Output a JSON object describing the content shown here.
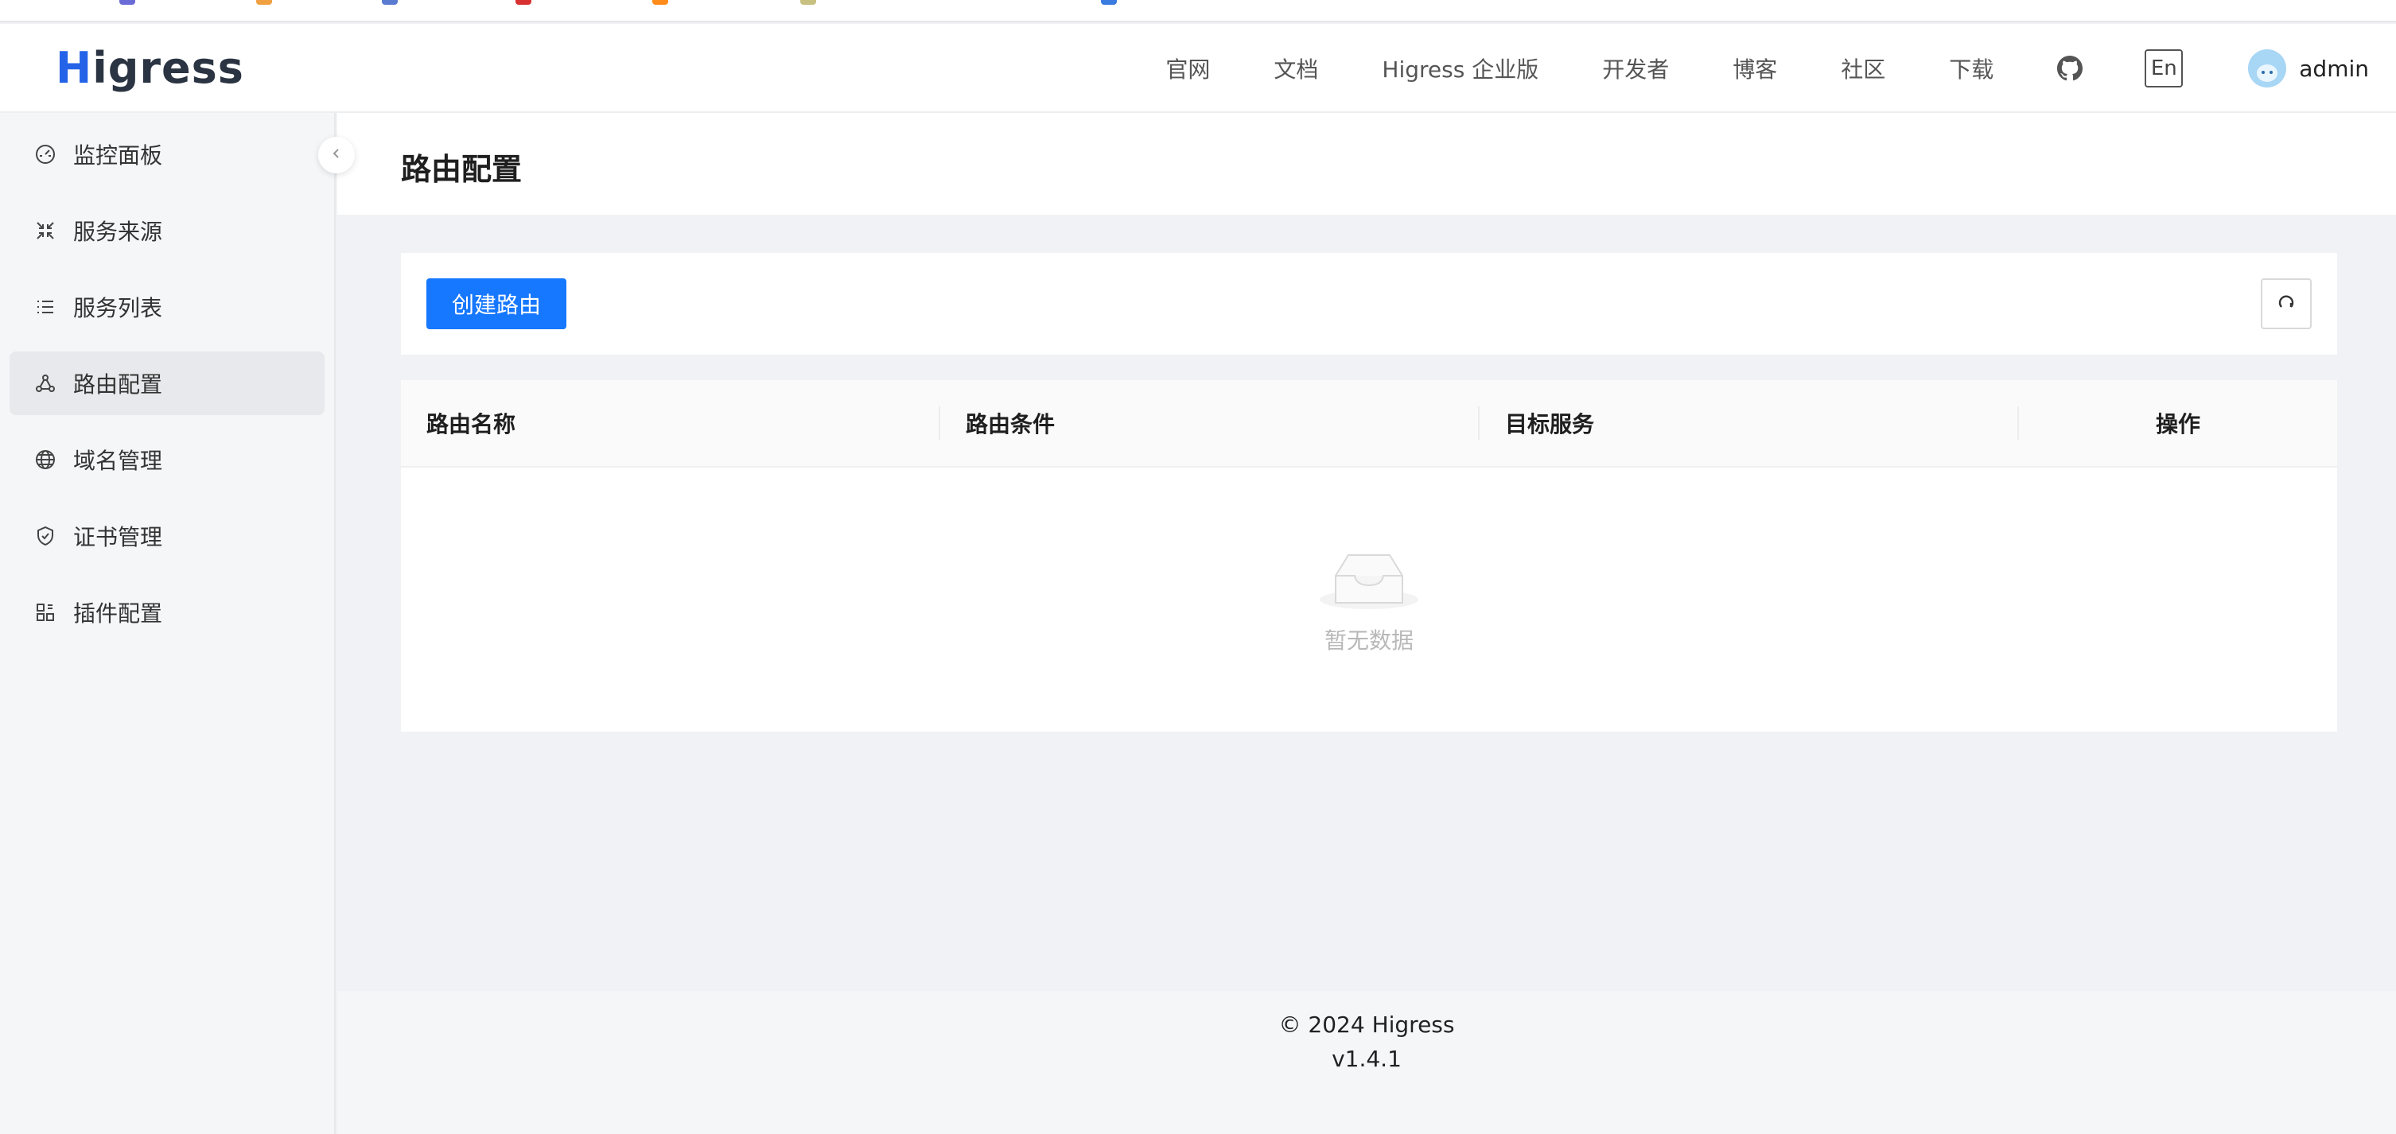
{
  "header": {
    "logo_text": "Higress",
    "nav": [
      "官网",
      "文档",
      "Higress 企业版",
      "开发者",
      "博客",
      "社区",
      "下载"
    ],
    "github_icon": "github-icon",
    "lang_label": "En",
    "user_name": "admin"
  },
  "sidebar": {
    "items": [
      {
        "label": "监控面板",
        "icon": "dashboard-icon"
      },
      {
        "label": "服务来源",
        "icon": "arrows-in-icon"
      },
      {
        "label": "服务列表",
        "icon": "list-icon"
      },
      {
        "label": "路由配置",
        "icon": "network-icon",
        "active": true
      },
      {
        "label": "域名管理",
        "icon": "globe-icon"
      },
      {
        "label": "证书管理",
        "icon": "shield-icon"
      },
      {
        "label": "插件配置",
        "icon": "plugin-icon"
      }
    ]
  },
  "page": {
    "title": "路由配置",
    "create_label": "创建路由",
    "table": {
      "columns": [
        "路由名称",
        "路由条件",
        "目标服务",
        "操作"
      ],
      "empty_text": "暂无数据"
    }
  },
  "footer": {
    "copyright": "© 2024 Higress",
    "version": "v1.4.1"
  },
  "colors": {
    "primary": "#1677ff",
    "sidebar_bg": "#f5f6f8",
    "content_bg": "#f0f2f5"
  }
}
